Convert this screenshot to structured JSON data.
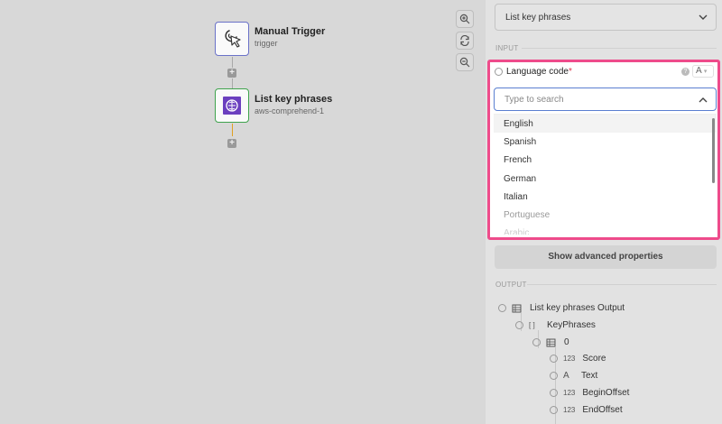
{
  "canvas": {
    "nodes": [
      {
        "title": "Manual Trigger",
        "subtitle": "trigger",
        "icon": "cursor-click-icon"
      },
      {
        "title": "List key phrases",
        "subtitle": "aws-comprehend-1",
        "icon": "aws-comprehend-brain-icon",
        "accent": "#6b3fbf"
      }
    ],
    "zoom_controls": [
      "zoom-in-icon",
      "reset-rotate-icon",
      "zoom-out-icon"
    ]
  },
  "panel": {
    "operation_select": "List key phrases",
    "input_section": "INPUT",
    "field": {
      "label": "Language code",
      "required_marker": "*",
      "type_indicator": "A",
      "search_placeholder": "Type to search",
      "options": [
        "English",
        "Spanish",
        "French",
        "German",
        "Italian",
        "Portuguese",
        "Arabic"
      ],
      "highlighted_option": "English"
    },
    "advanced_button": "Show advanced properties",
    "output_section": "OUTPUT",
    "output_tree": [
      {
        "label": "List key phrases Output",
        "type": "table"
      },
      {
        "label": "KeyPhrases",
        "type": "[ ]"
      },
      {
        "label": "0",
        "type": "table"
      },
      {
        "label": "Score",
        "type": "123"
      },
      {
        "label": "Text",
        "type": "A"
      },
      {
        "label": "BeginOffset",
        "type": "123"
      },
      {
        "label": "EndOffset",
        "type": "123"
      }
    ]
  },
  "colors": {
    "highlight_border": "#ee4b8b",
    "trigger_border": "#6b72c8",
    "comprehend_border": "#3fa34d",
    "connector_active": "#e0a020",
    "search_focus": "#5b7fd1"
  }
}
